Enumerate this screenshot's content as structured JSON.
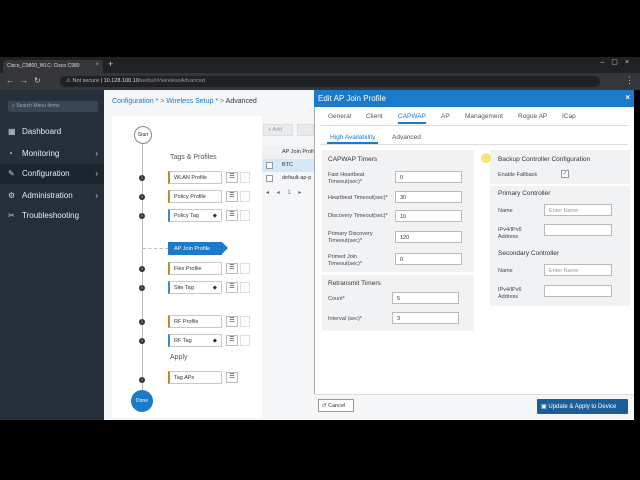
{
  "browser": {
    "tab_title": "Cisco_C9800_WLC: Cisco C980",
    "tab_close": "×",
    "new_tab": "+",
    "window_controls": "–▢×",
    "nav_buttons": "←→↻",
    "security_label": "Not secure",
    "url_host": "10.128.100.10",
    "url_path": "/webui/#/wirelessAdvanced",
    "menu": "⋮"
  },
  "sidebar": {
    "search_placeholder": "Search Menu Items",
    "items": [
      {
        "label": "Dashboard",
        "icon": "dashboard-icon",
        "glyph": "▦",
        "chevron": ""
      },
      {
        "label": "Monitoring",
        "icon": "monitoring-icon",
        "glyph": "◔",
        "chevron": "›"
      },
      {
        "label": "Configuration",
        "icon": "configuration-icon",
        "glyph": "✎",
        "chevron": "›"
      },
      {
        "label": "Administration",
        "icon": "administration-icon",
        "glyph": "⚙",
        "chevron": "›"
      },
      {
        "label": "Troubleshooting",
        "icon": "troubleshooting-icon",
        "glyph": "✂",
        "chevron": ""
      }
    ]
  },
  "breadcrumb": {
    "item1": "Configuration *",
    "item2": "Wireless Setup *",
    "current": "Advanced",
    "sep": ">"
  },
  "flow": {
    "start": "Start",
    "done": "Done",
    "section_tags": "Tags & Profiles",
    "section_apply": "Apply",
    "info_glyph": "i",
    "list_glyph": "☰",
    "small_glyph": "⋮",
    "items": {
      "wlan": "WLAN Profile",
      "policy": "Policy Profile",
      "policy_tag": "Policy Tag",
      "ap_join": "AP Join Profile",
      "flex": "Flex Profile",
      "site_tag": "Site Tag",
      "rf_profile": "RF Profile",
      "rf_tag": "RF Tag",
      "tag_aps": "Tag APs"
    }
  },
  "table": {
    "add_label": "+ Add",
    "header": "AP Join Profi",
    "rows": [
      "BTC",
      "default-ap-p"
    ],
    "pager": "◂ ◂ 1 ▸"
  },
  "modal": {
    "title": "Edit AP Join Profile",
    "close": "×",
    "tabs": [
      "General",
      "Client",
      "CAPWAP",
      "AP",
      "Management",
      "Rogue AP",
      "ICap"
    ],
    "active_tab": "CAPWAP",
    "subtabs": [
      "High Availability",
      "Advanced"
    ],
    "active_subtab": "High Availability",
    "capwap_timers_title": "CAPWAP Timers",
    "fast_heartbeat_label": "Fast Heartbeat Timeout(sec)*",
    "fast_heartbeat_value": "0",
    "heartbeat_label": "Heartbeat Timeout(sec)*",
    "heartbeat_value": "30",
    "discovery_label": "Discovery Timeout(sec)*",
    "discovery_value": "10",
    "primary_discovery_label": "Primary Discovery Timeout(sec)*",
    "primary_discovery_value": "120",
    "primed_join_label": "Primed Join Timeout(sec)*",
    "primed_join_value": "0",
    "retransmit_title": "Retransmit Timers",
    "count_label": "Count*",
    "count_value": "5",
    "interval_label": "Interval (sec)*",
    "interval_value": "3",
    "backup_title": "Backup Controller Configuration",
    "enable_fallback_label": "Enable Fallback",
    "enable_fallback_check": "✓",
    "primary_controller_title": "Primary Controller",
    "secondary_controller_title": "Secondary Controller",
    "name_label": "Name",
    "name_placeholder": "Enter Name",
    "ip_label": "IPv4/IPv6 Address",
    "cancel_label": "↺ Cancel",
    "apply_label": "Update & Apply to Device"
  },
  "colors": {
    "accent": "#1b7ac9",
    "sidebar_bg": "#252e3b",
    "apply_bg": "#1b5e98"
  }
}
